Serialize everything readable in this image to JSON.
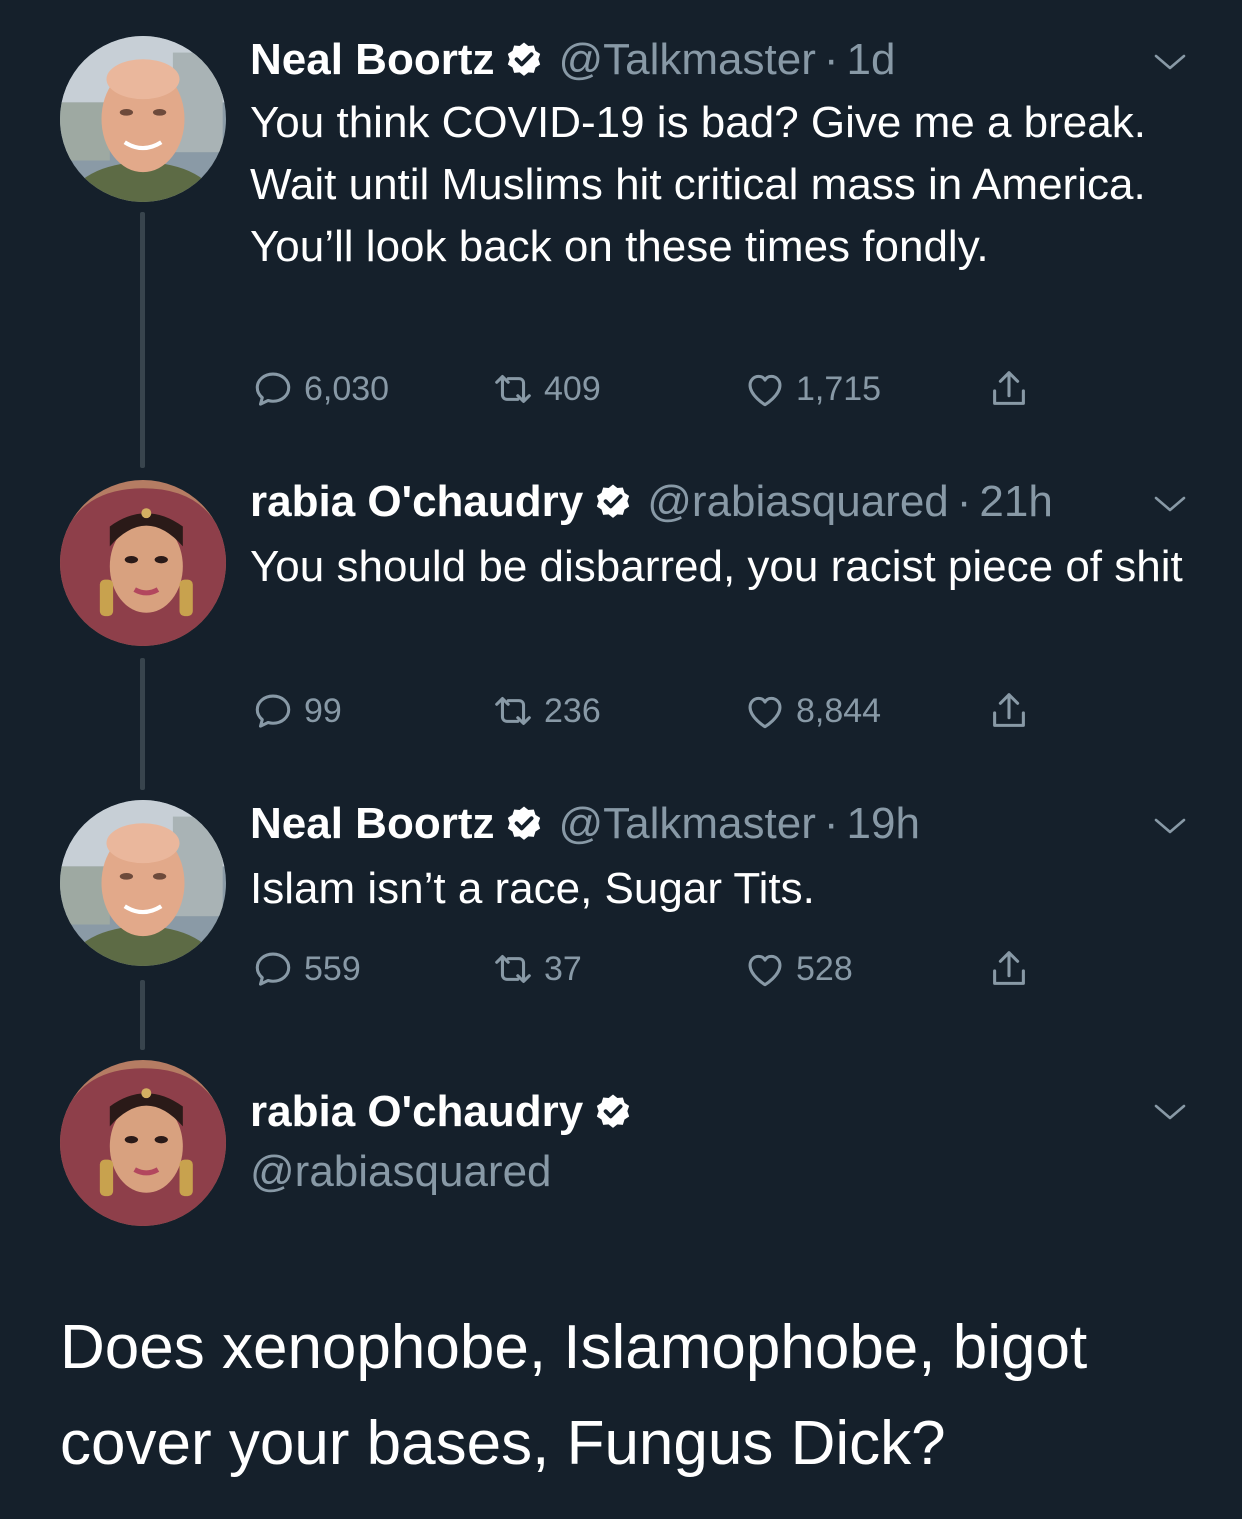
{
  "tweets": [
    {
      "name": "Neal Boortz",
      "handle": "@Talkmaster",
      "separator": "·",
      "time": "1d",
      "text": "You think COVID-19 is bad? Give me a break.  Wait until Muslims hit critical mass in America. You’ll look back on these times fondly.",
      "replies": "6,030",
      "retweets": "409",
      "likes": "1,715"
    },
    {
      "name": "rabia O'chaudry",
      "handle": "@rabiasquared",
      "separator": "·",
      "time": "21h",
      "text": "You should be disbarred, you racist piece of shit",
      "replies": "99",
      "retweets": "236",
      "likes": "8,844"
    },
    {
      "name": "Neal Boortz",
      "handle": "@Talkmaster",
      "separator": "·",
      "time": "19h",
      "text": "Islam isn’t a race, Sugar Tits.",
      "replies": "559",
      "retweets": "37",
      "likes": "528"
    }
  ],
  "focused": {
    "name": "rabia O'chaudry",
    "handle": "@rabiasquared",
    "text": "Does xenophobe, Islamophobe, bigot cover your bases, Fungus Dick?"
  },
  "colors": {
    "background": "#15202b",
    "secondary_text": "#8899a6",
    "verified_badge": "#ffffff",
    "thread_line": "#38444d"
  },
  "icons": [
    "reply-icon",
    "retweet-icon",
    "like-icon",
    "share-icon",
    "verified-badge-icon",
    "chevron-down-icon"
  ]
}
